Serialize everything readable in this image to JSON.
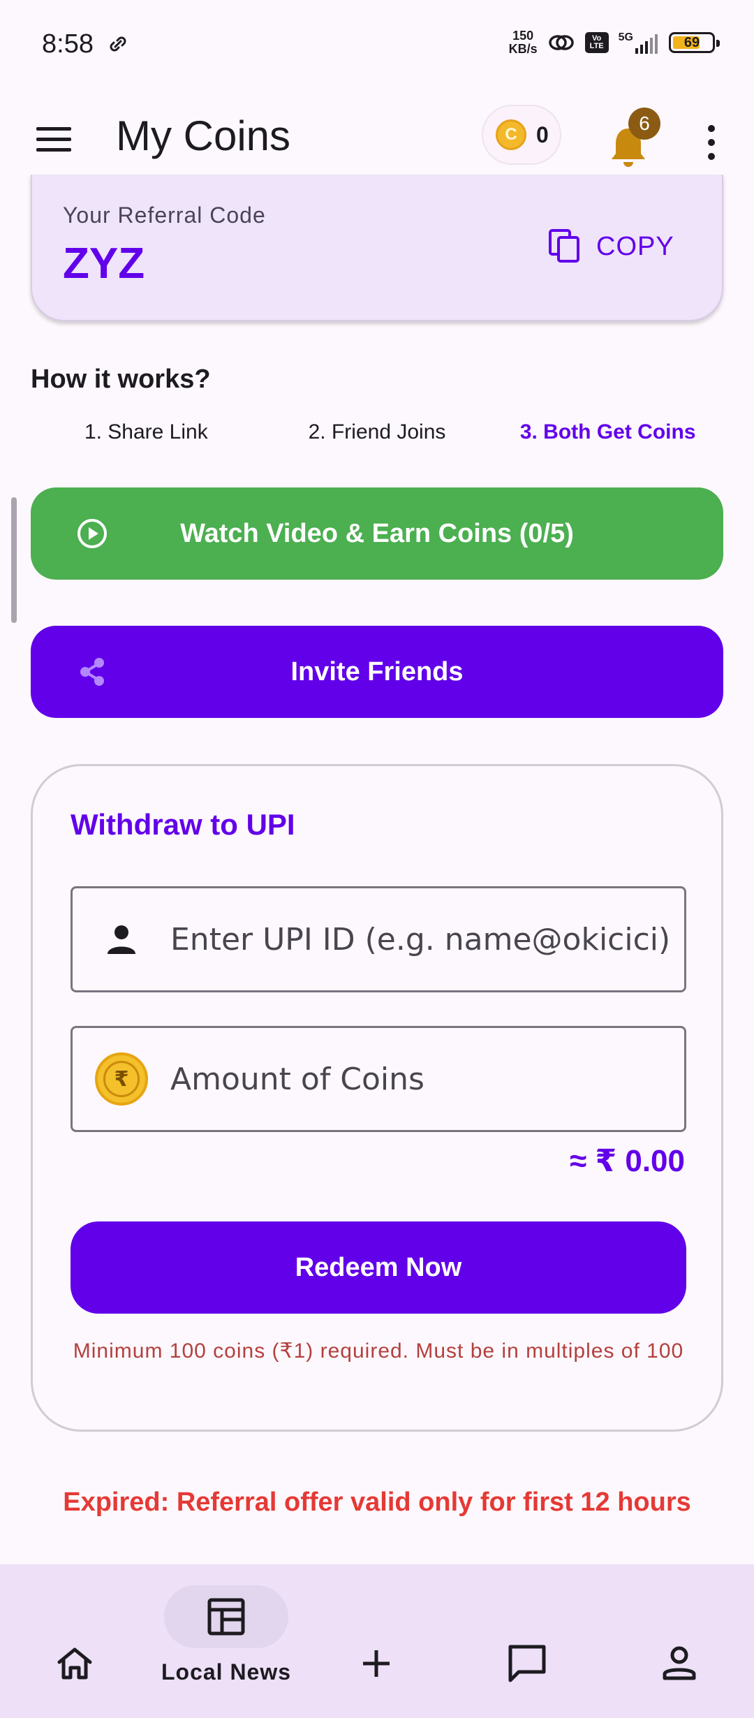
{
  "status_bar": {
    "time": "8:58",
    "speed_value": "150",
    "speed_unit": "KB/s",
    "network": "5G",
    "volte_label": "Vo LTE",
    "battery": "69"
  },
  "app_bar": {
    "title": "My Coins",
    "coin_balance": "0",
    "coin_symbol": "C",
    "notification_count": "6"
  },
  "referral": {
    "label": "Your Referral Code",
    "code": "ZYZ",
    "copy_label": "COPY"
  },
  "how_it_works": {
    "title": "How it works?",
    "steps": [
      "1. Share Link",
      "2. Friend Joins",
      "3. Both Get Coins"
    ],
    "active_step": 3
  },
  "actions": {
    "watch_label": "Watch Video & Earn Coins (0/5)",
    "invite_label": "Invite Friends"
  },
  "withdraw": {
    "title": "Withdraw to UPI",
    "upi_placeholder": "Enter UPI ID (e.g. name@okicici)",
    "amount_placeholder": "Amount of Coins",
    "approx_value": "≈ ₹ 0.00",
    "redeem_label": "Redeem Now",
    "min_note": "Minimum 100 coins (₹1) required. Must be in multiples of 100"
  },
  "expired_notice": "Expired: Referral offer valid only for first 12 hours",
  "bottom_nav": {
    "active_label": "Local News"
  },
  "colors": {
    "primary": "#6200ea",
    "watch_green": "#4caf50",
    "error_red": "#e53935",
    "note_red": "#b3403e",
    "nav_background": "#ede0f7",
    "badge_brown": "#8b5b13"
  }
}
